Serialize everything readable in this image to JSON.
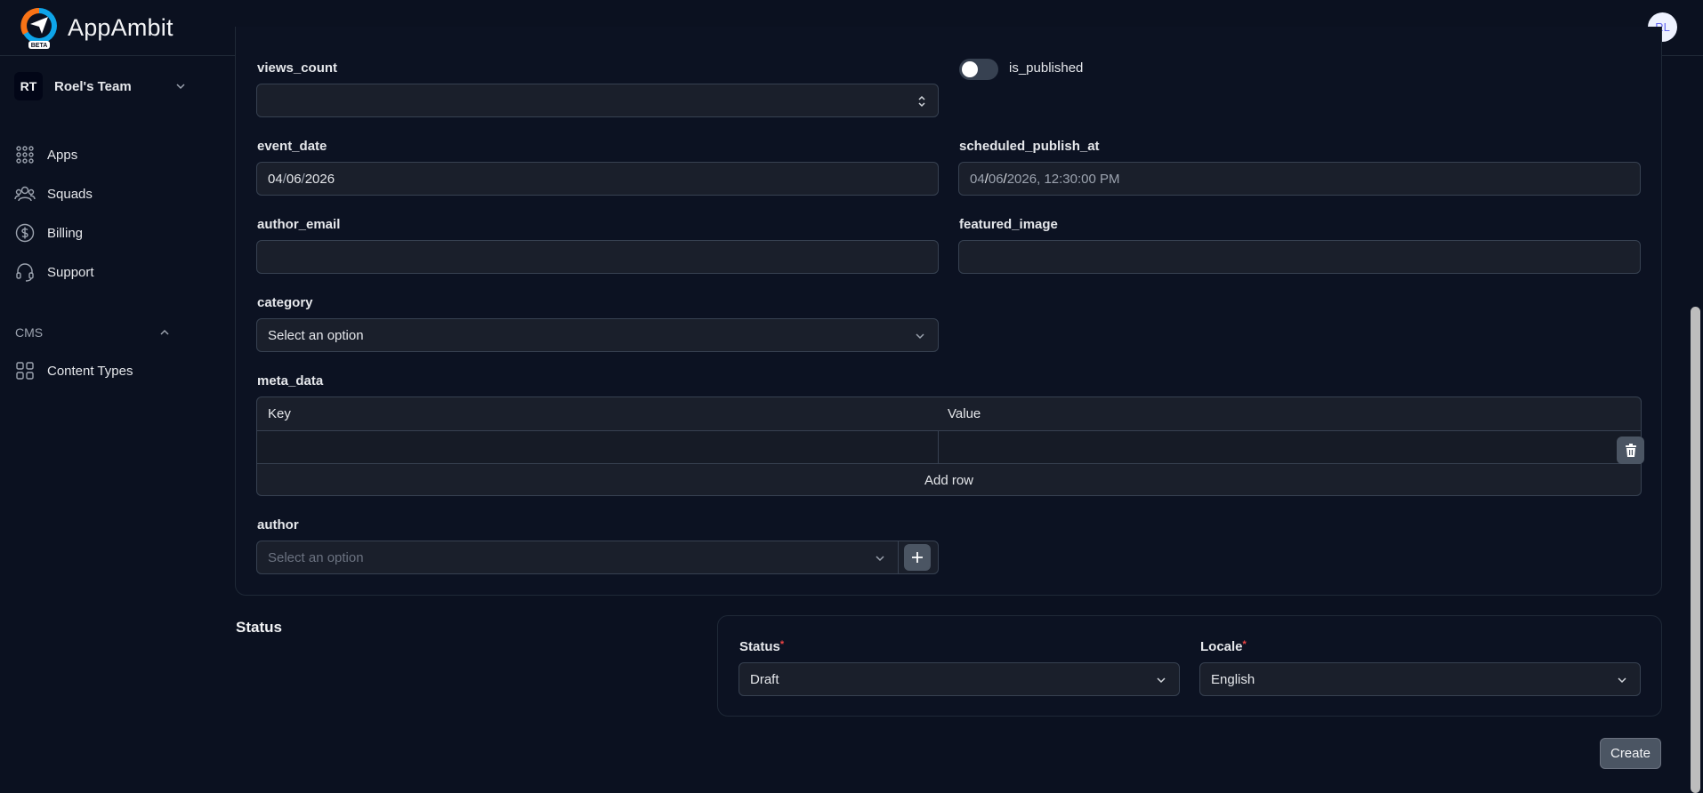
{
  "app": {
    "brand": "AppAmbit",
    "beta": "BETA",
    "user_initials": "RL"
  },
  "sidebar": {
    "team": {
      "initials": "RT",
      "name": "Roel's Team"
    },
    "items": [
      {
        "label": "Apps",
        "icon": "grid-dots-icon"
      },
      {
        "label": "Squads",
        "icon": "users-icon"
      },
      {
        "label": "Billing",
        "icon": "dollar-circle-icon"
      },
      {
        "label": "Support",
        "icon": "headset-icon"
      }
    ],
    "cms_section": "CMS",
    "cms_items": [
      {
        "label": "Content Types",
        "icon": "squares-icon"
      }
    ]
  },
  "form": {
    "views_count": {
      "label": "views_count",
      "value": ""
    },
    "is_published": {
      "label": "is_published",
      "value": false
    },
    "event_date": {
      "label": "event_date",
      "mm": "04",
      "dd": "06",
      "yyyy": "2026"
    },
    "scheduled_publish_at": {
      "label": "scheduled_publish_at",
      "mm": "04",
      "dd": "06",
      "yyyy": "2026",
      "time": "12:30:00 PM"
    },
    "author_email": {
      "label": "author_email",
      "value": ""
    },
    "featured_image": {
      "label": "featured_image",
      "value": ""
    },
    "category": {
      "label": "category",
      "value": "Select an option"
    },
    "meta_data": {
      "label": "meta_data",
      "key_header": "Key",
      "value_header": "Value",
      "add_row": "Add row"
    },
    "author": {
      "label": "author",
      "placeholder": "Select an option"
    }
  },
  "status_section": {
    "title": "Status",
    "status": {
      "label": "Status",
      "value": "Draft"
    },
    "locale": {
      "label": "Locale",
      "value": "English"
    },
    "required_mark": "*"
  },
  "actions": {
    "create": "Create"
  },
  "colors": {
    "background": "#0b1120",
    "field": "#1a1f2b",
    "border": "#374151",
    "required": "#ef4444"
  }
}
